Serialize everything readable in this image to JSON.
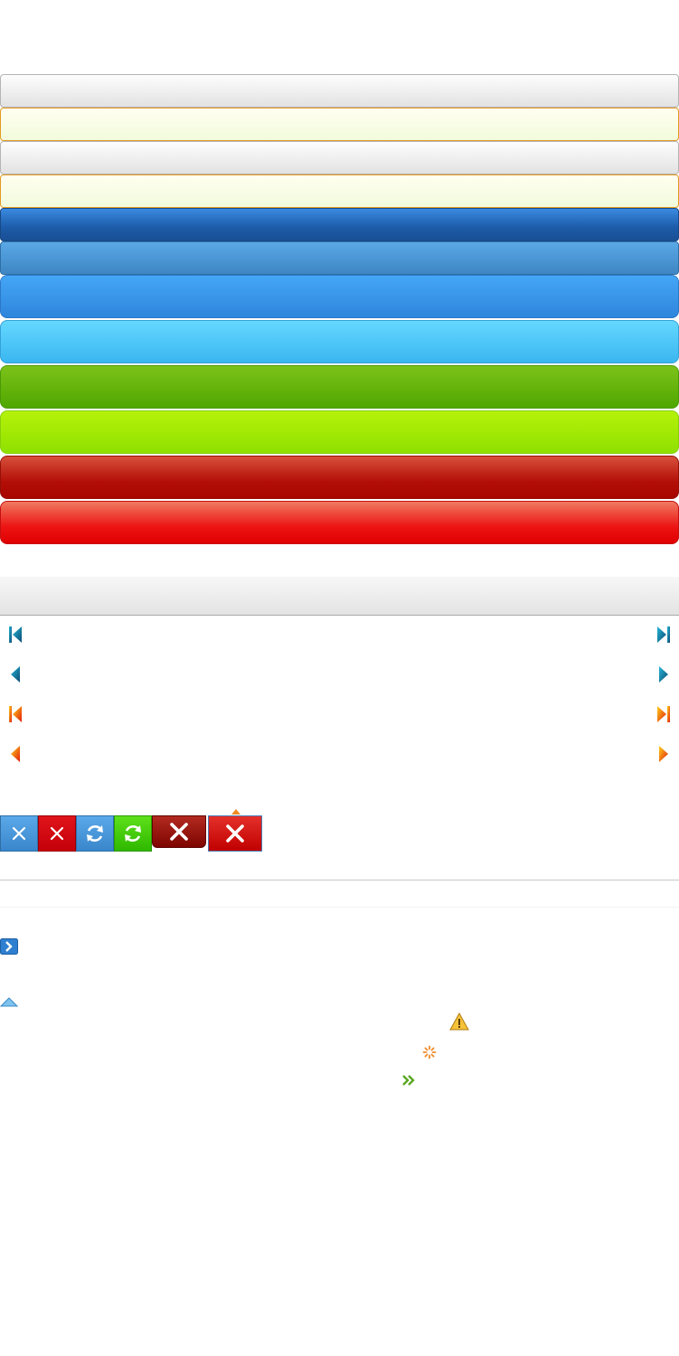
{
  "title": "",
  "style_bars": [
    {
      "name": "gray-bar",
      "color": "#e6e6e6"
    },
    {
      "name": "yellow-bar",
      "color": "#f7fde2"
    },
    {
      "name": "gray-bar",
      "color": "#e6e6e6"
    },
    {
      "name": "yellow-bar",
      "color": "#f7fde2"
    },
    {
      "name": "navy-bar",
      "color": "#1c5ba8"
    },
    {
      "name": "steel-blue-bar",
      "color": "#3e86c4"
    },
    {
      "name": "blue-bar",
      "color": "#2f86dc"
    },
    {
      "name": "sky-blue-bar",
      "color": "#3ab6f0"
    },
    {
      "name": "green-bar",
      "color": "#4fa700"
    },
    {
      "name": "lime-bar",
      "color": "#8fe000"
    },
    {
      "name": "dark-red-bar",
      "color": "#b30f08"
    },
    {
      "name": "red-bar",
      "color": "#e00000"
    }
  ],
  "pager": {
    "icons": [
      "first-page-icon",
      "prev-page-icon",
      "next-page-icon",
      "last-page-icon"
    ],
    "color_sets": [
      "teal",
      "orange"
    ]
  },
  "buttons": [
    "close-icon",
    "close-icon",
    "refresh-icon",
    "refresh-icon",
    "close-icon",
    "close-icon"
  ],
  "misc_icons": [
    "expand-arrow-icon",
    "collapse-caret-icon",
    "warning-icon",
    "loading-spinner-icon",
    "double-chevron-icon"
  ]
}
